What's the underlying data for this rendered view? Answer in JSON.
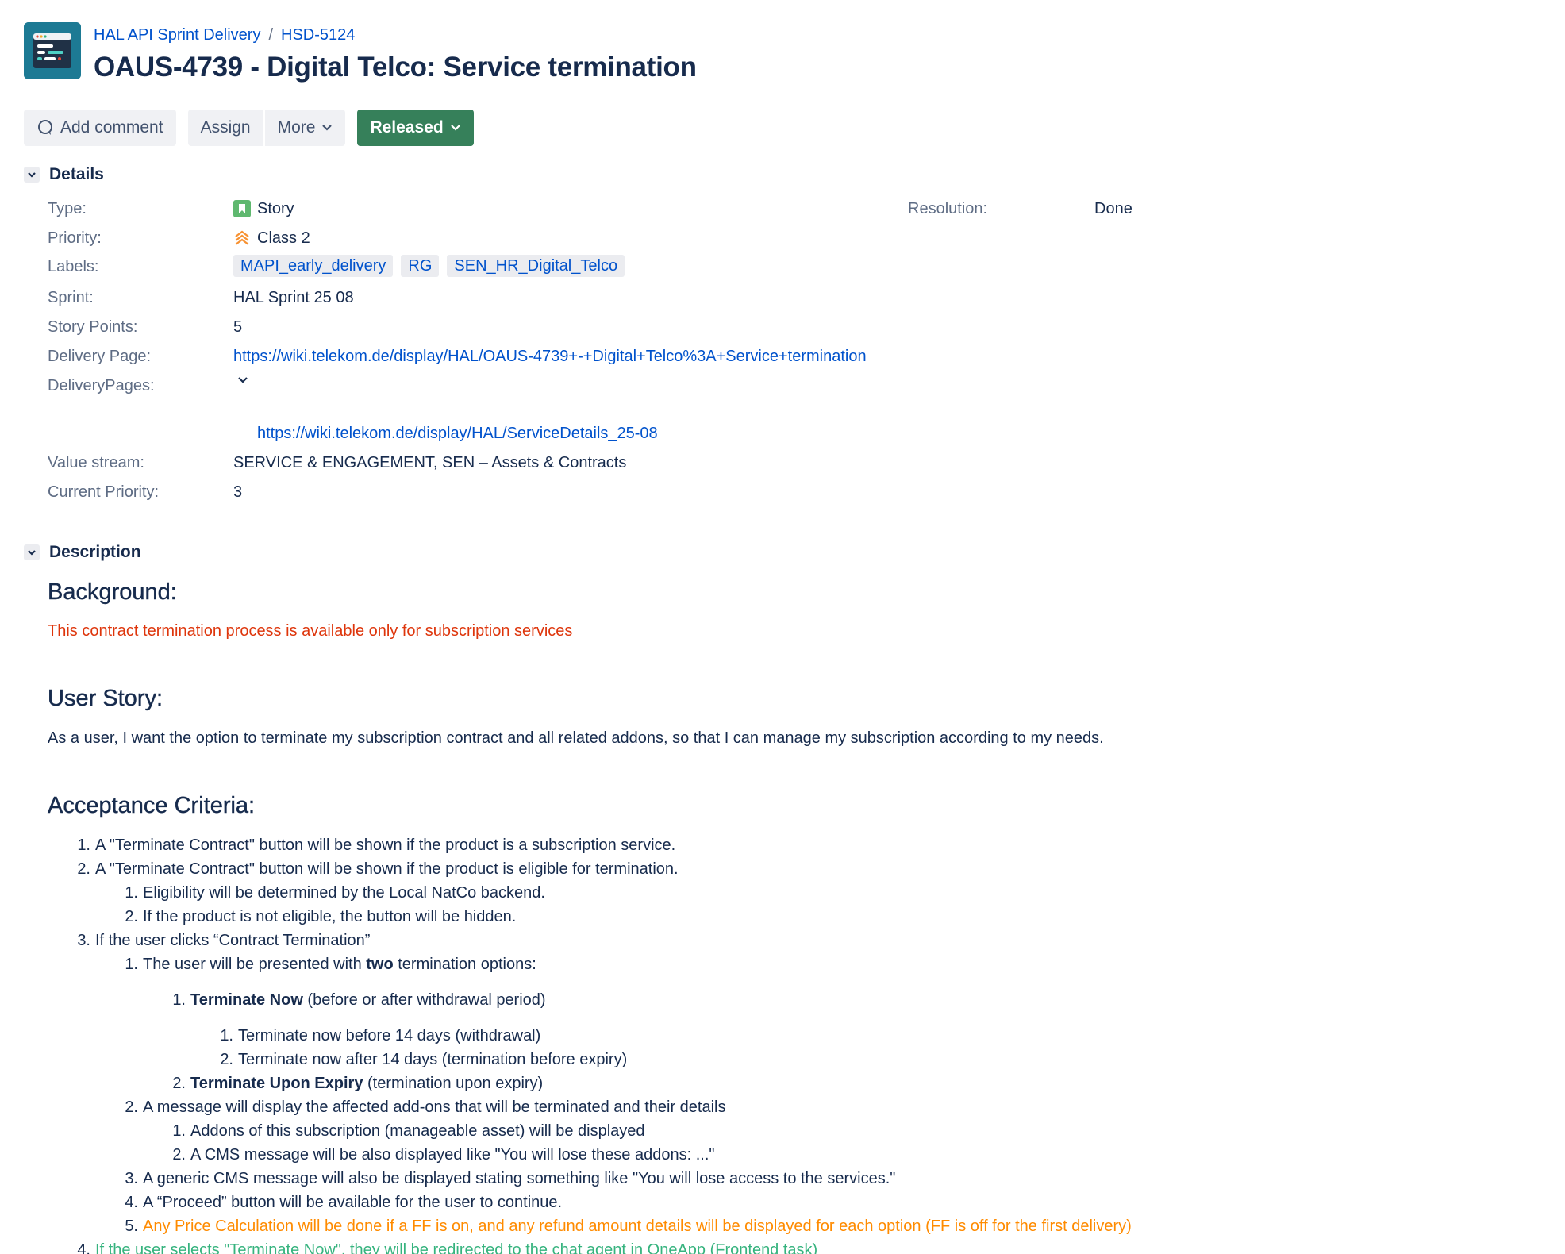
{
  "breadcrumb": {
    "project": "HAL API Sprint Delivery",
    "separator": "/",
    "parent_key": "HSD-5124"
  },
  "issue": {
    "title": "OAUS-4739 - Digital Telco: Service termination"
  },
  "toolbar": {
    "add_comment": "Add comment",
    "assign": "Assign",
    "more": "More",
    "status": "Released"
  },
  "colors": {
    "status_green": "#36805a",
    "link_blue": "#0052cc",
    "story_green": "#5fb86f",
    "priority_orange": "#f79232"
  },
  "details": {
    "section_title": "Details",
    "type": {
      "label": "Type:",
      "value": "Story",
      "icon": "story-icon"
    },
    "priority": {
      "label": "Priority:",
      "value": "Class 2",
      "icon": "priority-chevrons-icon"
    },
    "labels": {
      "label": "Labels:",
      "items": [
        "MAPI_early_delivery",
        "RG",
        "SEN_HR_Digital_Telco"
      ]
    },
    "sprint": {
      "label": "Sprint:",
      "value": "HAL Sprint 25 08"
    },
    "story_points": {
      "label": "Story Points:",
      "value": "5"
    },
    "delivery_page": {
      "label": "Delivery Page:",
      "value": "https://wiki.telekom.de/display/HAL/OAUS-4739+-+Digital+Telco%3A+Service+termination"
    },
    "delivery_pages": {
      "label": "DeliveryPages:",
      "link": "https://wiki.telekom.de/display/HAL/ServiceDetails_25-08"
    },
    "value_stream": {
      "label": "Value stream:",
      "value": "SERVICE & ENGAGEMENT, SEN – Assets & Contracts"
    },
    "current_priority": {
      "label": "Current Priority:",
      "value": "3"
    },
    "resolution": {
      "label": "Resolution:",
      "value": "Done"
    }
  },
  "description": {
    "section_title": "Description",
    "background_heading": "Background:",
    "background_text": "This contract termination process is available only for subscription services",
    "user_story_heading": "User Story:",
    "user_story_text": "As a user, I want the option to terminate my subscription contract and all related addons, so that I can manage my subscription according to my needs.",
    "ac_heading": "Acceptance Criteria:",
    "ac": {
      "i1": "A \"Terminate Contract\" button will be shown if the product is a subscription service.",
      "i2": "A \"Terminate Contract\" button will be shown if the product is eligible for termination.",
      "i2_1": "Eligibility will be determined by the Local NatCo backend.",
      "i2_2": "If the product is not eligible, the button will be hidden.",
      "i3": "If the user clicks “Contract Termination”",
      "i3_1_pre": "The user will be presented with ",
      "i3_1_bold": "two",
      "i3_1_post": " termination options:",
      "i3_1_1_bold": "Terminate Now",
      "i3_1_1_post": " (before or after withdrawal period)",
      "i3_1_1_1": "Terminate now before 14 days (withdrawal)",
      "i3_1_1_2": "Terminate now after 14 days (termination before expiry)",
      "i3_1_2_bold": "Terminate Upon Expiry",
      "i3_1_2_post": " (termination upon expiry)",
      "i3_2": "A message will display the affected add-ons that will be terminated and their details",
      "i3_2_1": "Addons of this subscription (manageable asset) will be displayed",
      "i3_2_2": "A CMS message will be also displayed like \"You will lose these addons: ...\"",
      "i3_3": "A generic CMS message will also be displayed stating something like \"You will lose access to the services.\"",
      "i3_4": "A “Proceed” button will be available for the user to continue.",
      "i3_5": "Any Price Calculation will be done if a FF is on, and any refund amount details will be displayed for each option (FF is off for the first delivery)",
      "i4": "If the user selects \"Terminate Now\", they will be redirected to the chat agent in OneApp (Frontend task)"
    },
    "numbers": {
      "n1": "1.",
      "n2": "2.",
      "n3": "3.",
      "n4": "4.",
      "n5": "5."
    }
  }
}
